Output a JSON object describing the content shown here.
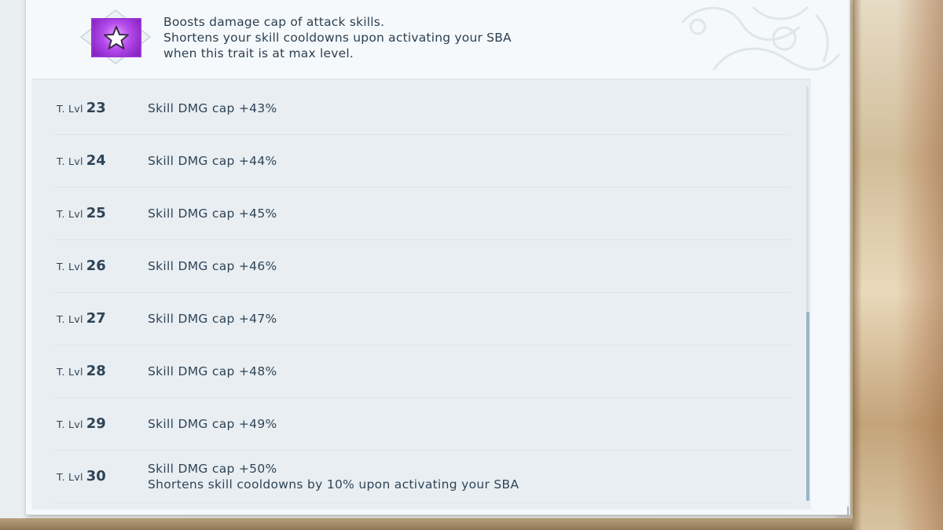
{
  "trait": {
    "icon": "star-icon",
    "description": [
      "Boosts damage cap of attack skills.",
      "Shortens your skill cooldowns upon activating your SBA",
      "when this trait is at max level."
    ]
  },
  "levels": [
    {
      "prefix": "T. Lvl",
      "level": "23",
      "effect": [
        "Skill DMG cap +43%"
      ]
    },
    {
      "prefix": "T. Lvl",
      "level": "24",
      "effect": [
        "Skill DMG cap +44%"
      ]
    },
    {
      "prefix": "T. Lvl",
      "level": "25",
      "effect": [
        "Skill DMG cap +45%"
      ]
    },
    {
      "prefix": "T. Lvl",
      "level": "26",
      "effect": [
        "Skill DMG cap +46%"
      ]
    },
    {
      "prefix": "T. Lvl",
      "level": "27",
      "effect": [
        "Skill DMG cap +47%"
      ]
    },
    {
      "prefix": "T. Lvl",
      "level": "28",
      "effect": [
        "Skill DMG cap +48%"
      ]
    },
    {
      "prefix": "T. Lvl",
      "level": "29",
      "effect": [
        "Skill DMG cap +49%"
      ]
    },
    {
      "prefix": "T. Lvl",
      "level": "30",
      "effect": [
        "Skill DMG cap +50%",
        "Shortens skill cooldowns by 10% upon activating your SBA"
      ]
    }
  ],
  "colors": {
    "text": "#2e4457",
    "icon_purple": "#b449ec",
    "scroll_thumb": "#9ab4c6"
  }
}
